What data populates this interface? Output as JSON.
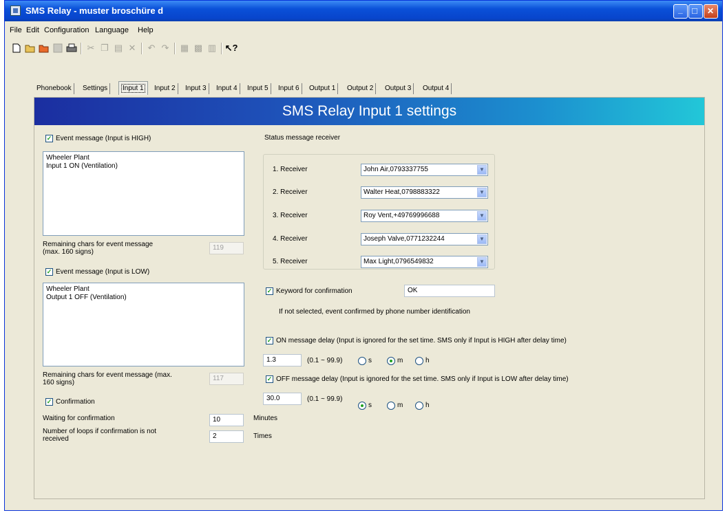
{
  "window": {
    "title": "SMS Relay - muster broschüre d"
  },
  "menu": [
    "File",
    "Edit",
    "Configuration",
    "Language",
    "Help"
  ],
  "tabs": [
    "Phonebook",
    "Settings",
    "Input 1",
    "Input 2",
    "Input 3",
    "Input 4",
    "Input 5",
    "Input 6",
    "Output 1",
    "Output 2",
    "Output 3",
    "Output 4"
  ],
  "banner": "SMS Relay Input 1 settings",
  "high": {
    "checkbox_label": "Event message (Input is HIGH)",
    "message": "Wheeler Plant\nInput 1 ON (Ventilation)",
    "remaining_label": "Remaining chars for event message\n(max. 160 signs)",
    "remaining_value": "119"
  },
  "low": {
    "checkbox_label": "Event message (Input is LOW)",
    "message": "Wheeler Plant\nOutput 1 OFF (Ventilation)",
    "remaining_label": "Remaining chars for event message (max.\n160 signs)",
    "remaining_value": "117"
  },
  "confirmation": {
    "checkbox_label": "Confirmation",
    "waiting_label": "Waiting for confirmation",
    "waiting_value": "10",
    "waiting_unit": "Minutes",
    "loops_label": "Number of loops if confirmation is not\nreceived",
    "loops_value": "2",
    "loops_unit": "Times"
  },
  "status": {
    "heading": "Status message receiver",
    "receivers": [
      {
        "label": "1. Receiver",
        "value": "John Air,0793337755"
      },
      {
        "label": "2. Receiver",
        "value": "Walter Heat,0798883322"
      },
      {
        "label": "3. Receiver",
        "value": "Roy Vent,+49769996688"
      },
      {
        "label": "4. Receiver",
        "value": "Joseph Valve,0771232244"
      },
      {
        "label": "5. Receiver",
        "value": "Max Light,0796549832"
      }
    ]
  },
  "keyword": {
    "checkbox_label": "Keyword for confirmation",
    "value": "OK",
    "note": "If not selected, event confirmed by phone number identification"
  },
  "on_delay": {
    "checkbox_label": "ON message delay (Input is ignored for the set time. SMS only if Input is HIGH after delay time)",
    "value": "1.3",
    "range": "(0.1 ~ 99.9)",
    "units": [
      "s",
      "m",
      "h"
    ],
    "selected": "m"
  },
  "off_delay": {
    "checkbox_label": "OFF message delay (Input is ignored for the set time. SMS only if Input is LOW after delay time)",
    "value": "30.0",
    "range": "(0.1 ~ 99.9)",
    "units": [
      "s",
      "m",
      "h"
    ],
    "selected": "s"
  },
  "glyphs": {
    "check": "✓",
    "minimize": "_",
    "maximize": "□",
    "close": "✕",
    "dropdown": "▼"
  }
}
